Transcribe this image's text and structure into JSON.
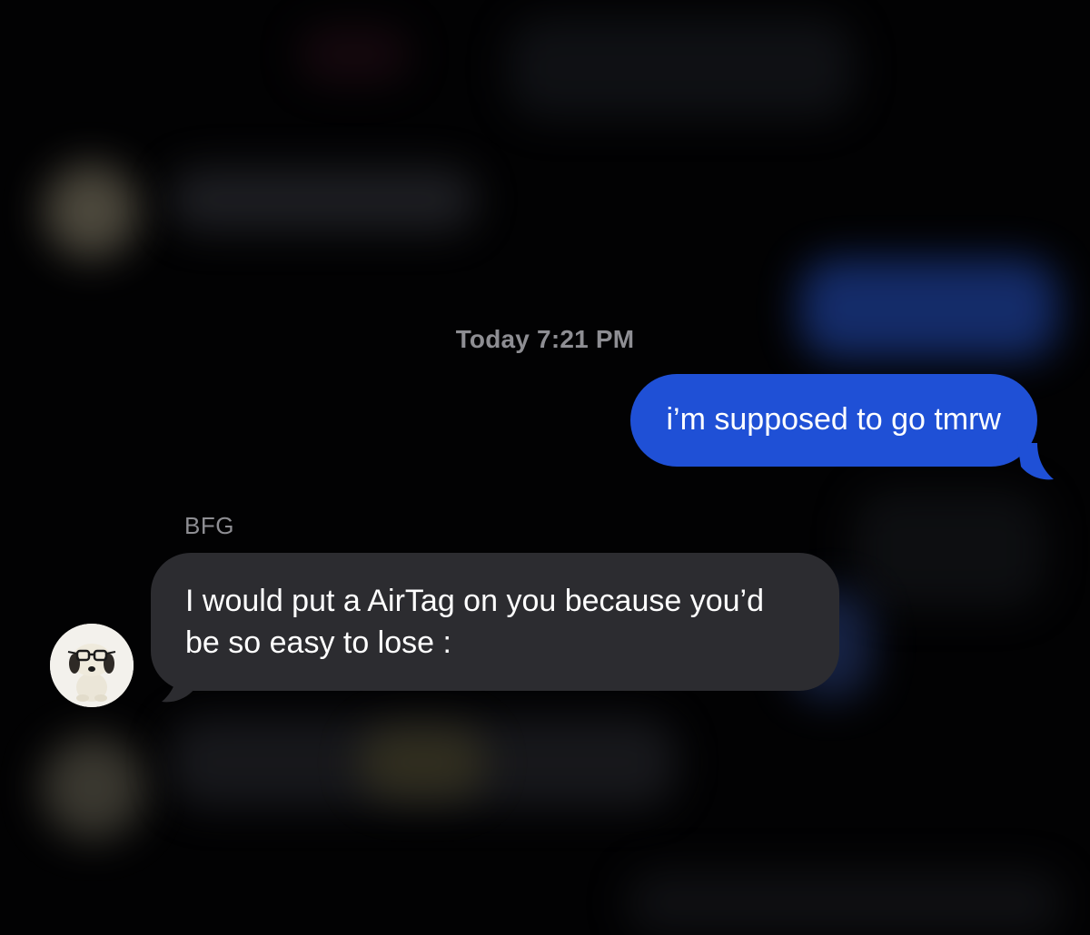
{
  "conversation": {
    "timestamp": "Today 7:21 PM",
    "messages": [
      {
        "direction": "outgoing",
        "text": "i’m supposed to go tmrw"
      },
      {
        "direction": "incoming",
        "sender": "BFG",
        "text": "I would put a AirTag on you because you’d be so easy to lose :"
      }
    ]
  },
  "colors": {
    "background": "#020203",
    "outgoing_bubble": "#1f50d6",
    "incoming_bubble": "#2c2c30",
    "meta_text": "#8e8e93"
  },
  "icons": {
    "contact_avatar": "snoopy-with-glasses-avatar"
  }
}
